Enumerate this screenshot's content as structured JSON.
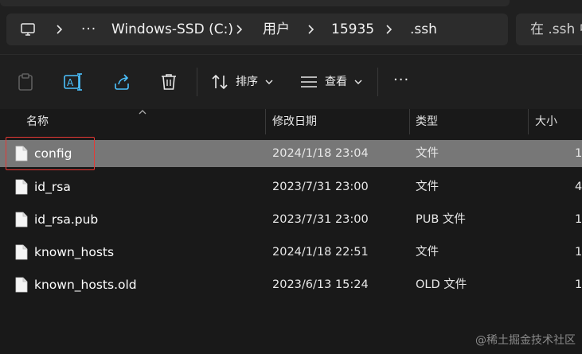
{
  "address": {
    "overflow_label": "···",
    "crumbs": [
      "Windows-SSD (C:)",
      "用户",
      "15935",
      ".ssh"
    ]
  },
  "search": {
    "placeholder": "在 .ssh 中"
  },
  "toolbar": {
    "sort_label": "排序",
    "view_label": "查看",
    "more_label": "···"
  },
  "columns": {
    "name": "名称",
    "modified": "修改日期",
    "type": "类型",
    "size": "大小"
  },
  "files": [
    {
      "name": "config",
      "modified": "2024/1/18 23:04",
      "type": "文件",
      "size": "1",
      "selected": true
    },
    {
      "name": "id_rsa",
      "modified": "2023/7/31 23:00",
      "type": "文件",
      "size": "4",
      "selected": false
    },
    {
      "name": "id_rsa.pub",
      "modified": "2023/7/31 23:00",
      "type": "PUB 文件",
      "size": "1",
      "selected": false
    },
    {
      "name": "known_hosts",
      "modified": "2024/1/18 22:51",
      "type": "文件",
      "size": "1",
      "selected": false
    },
    {
      "name": "known_hosts.old",
      "modified": "2023/6/13 15:24",
      "type": "OLD 文件",
      "size": "1",
      "selected": false
    }
  ],
  "watermark": "@稀土掘金技术社区",
  "colors": {
    "background": "#191919",
    "selected_row": "#777777",
    "highlight_border": "#e53935",
    "toolbar_icon_blue": "#4cc2ff"
  }
}
